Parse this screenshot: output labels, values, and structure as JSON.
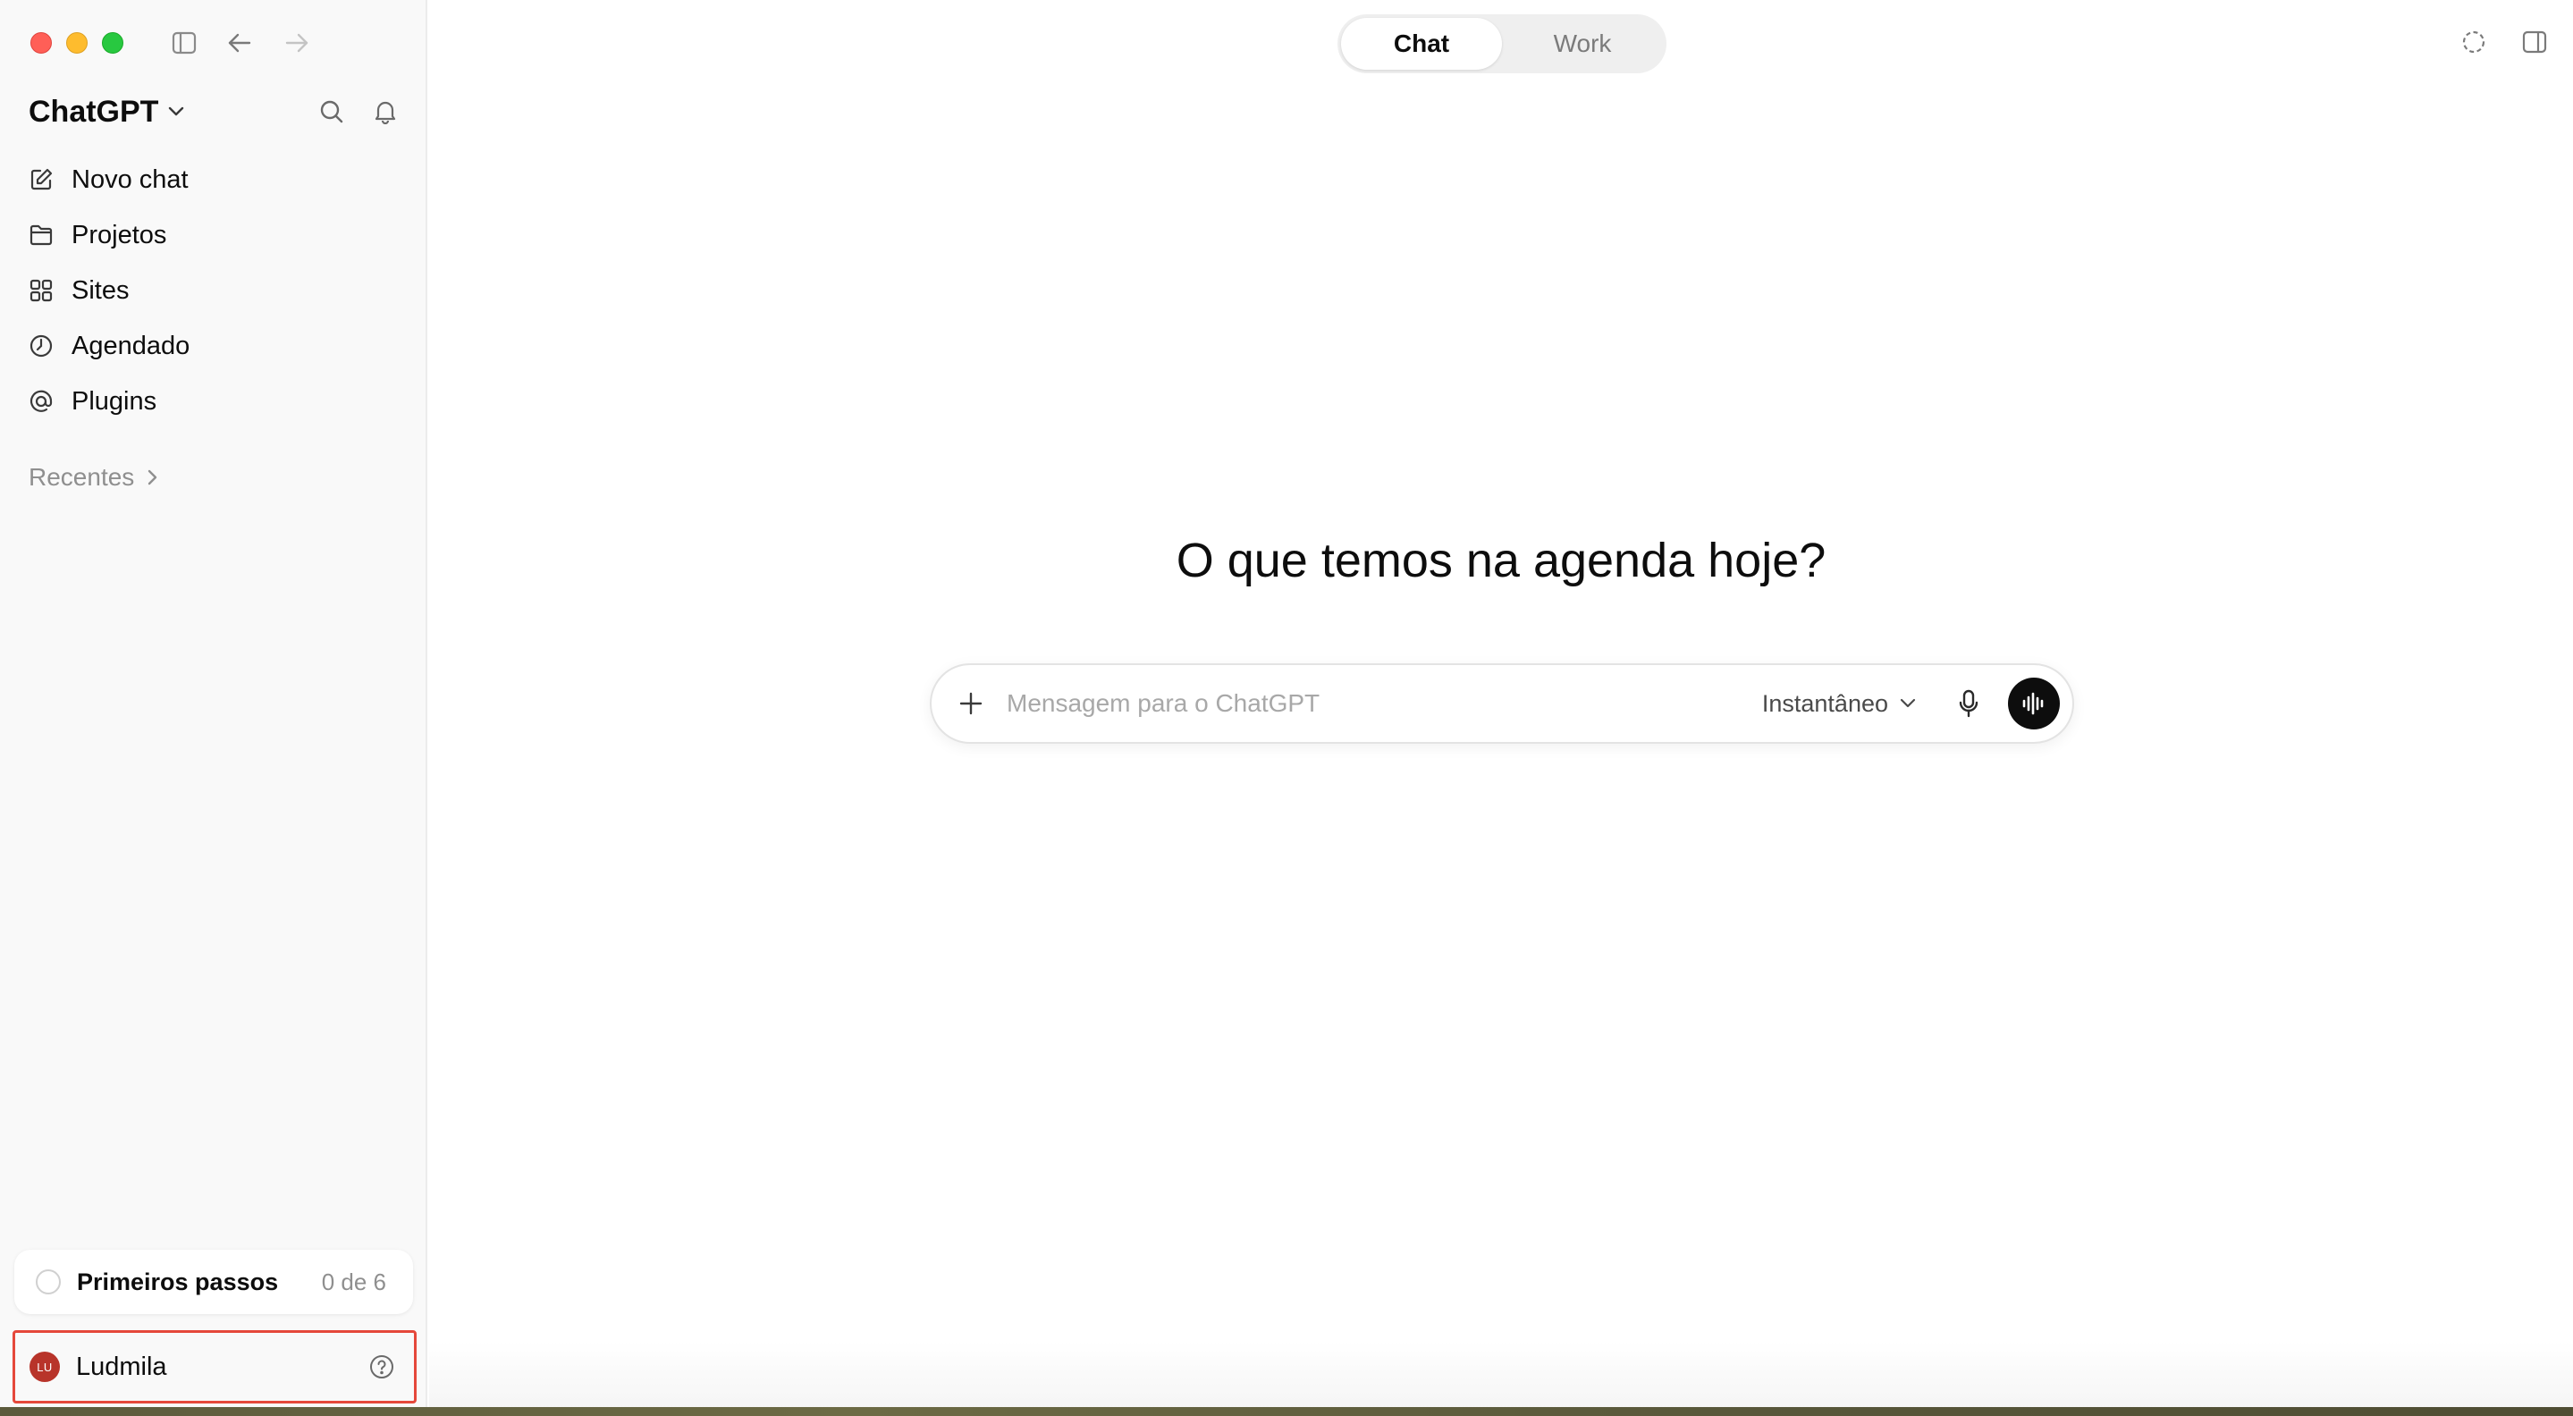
{
  "app": {
    "name": "ChatGPT"
  },
  "sidebar": {
    "nav": [
      {
        "label": "Novo chat",
        "icon": "edit-icon"
      },
      {
        "label": "Projetos",
        "icon": "folder-icon"
      },
      {
        "label": "Sites",
        "icon": "grid-icon"
      },
      {
        "label": "Agendado",
        "icon": "clock-icon"
      },
      {
        "label": "Plugins",
        "icon": "at-icon"
      }
    ],
    "recents_label": "Recentes",
    "onboarding": {
      "title": "Primeiros passos",
      "progress": "0 de 6"
    },
    "user": {
      "name": "Ludmila",
      "initials": "LU"
    }
  },
  "header": {
    "tabs": [
      {
        "label": "Chat",
        "active": true
      },
      {
        "label": "Work",
        "active": false
      }
    ]
  },
  "main": {
    "headline": "O que temos na agenda hoje?",
    "composer": {
      "placeholder": "Mensagem para o ChatGPT",
      "model": "Instantâneo"
    }
  },
  "colors": {
    "accent": "#0d0d0d",
    "sidebar_bg": "#f9f9f9",
    "highlight_border": "#e5483b",
    "avatar_bg": "#b8342a"
  }
}
